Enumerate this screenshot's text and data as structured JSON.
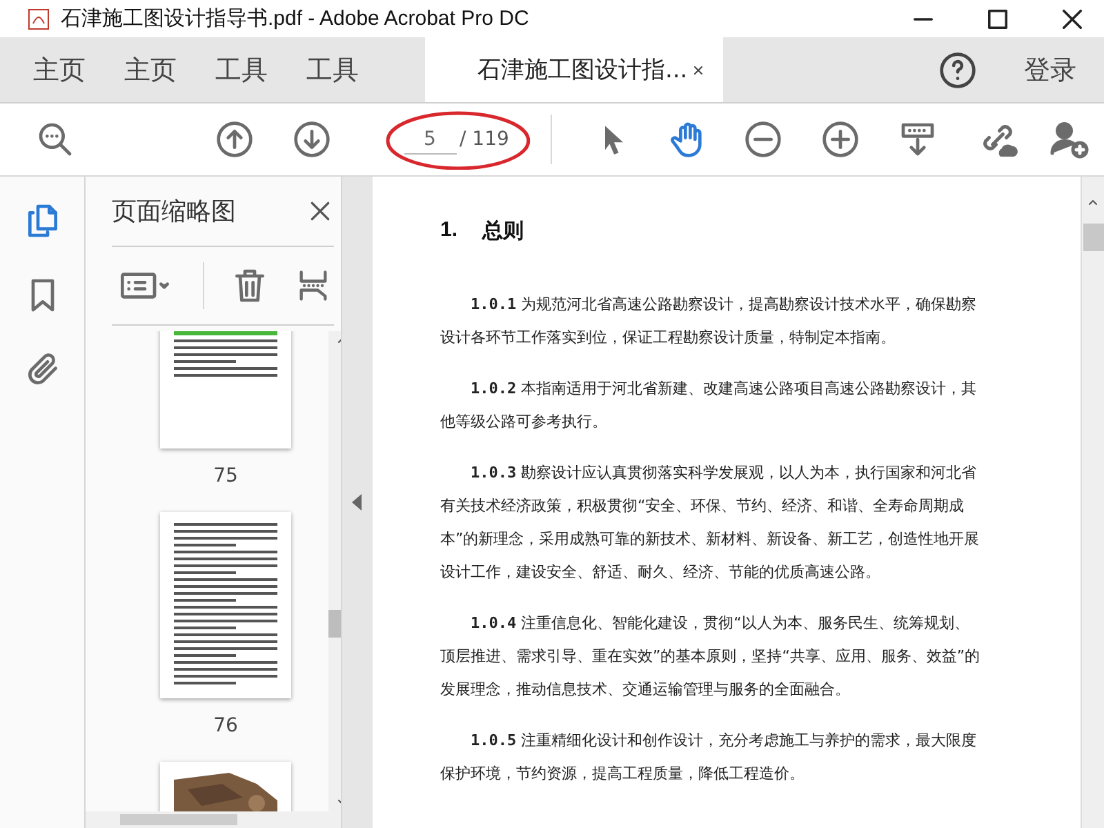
{
  "window": {
    "title": "石津施工图设计指导书.pdf - Adobe Acrobat Pro DC"
  },
  "tabs": [
    {
      "label": "主页",
      "kind": "nav",
      "selected": false
    },
    {
      "label": "主页",
      "kind": "nav",
      "selected": false
    },
    {
      "label": "工具",
      "kind": "nav",
      "selected": false
    },
    {
      "label": "工具",
      "kind": "nav",
      "selected": false
    },
    {
      "label": "石津施工图设计指...",
      "kind": "document",
      "selected": true
    }
  ],
  "signin": "登录",
  "toolbar": {
    "page_field": {
      "value": "5"
    },
    "page_total": "/ 119",
    "tools": [
      {
        "kind": "select",
        "selected": false
      },
      {
        "kind": "hand",
        "selected": true
      }
    ]
  },
  "side_rail": [
    {
      "kind": "thumbnails",
      "selected": true
    },
    {
      "kind": "bookmarks",
      "selected": false
    },
    {
      "kind": "attachments",
      "selected": false
    }
  ],
  "thumbnail_panel": {
    "title": "页面缩略图",
    "pages": [
      {
        "label": "75",
        "kind": "picture_page"
      },
      {
        "label": "76",
        "kind": "text_page"
      },
      {
        "kind": "photo_top_page"
      }
    ]
  },
  "document": {
    "heading_number": "1.",
    "heading": "总则",
    "paragraphs": [
      "**1.0.1** 为规范河北省高速公路勘察设计，提高勘察设计技术水平，确保勘察设计各环节工作落实到位，保证工程勘察设计质量，特制定本指南。",
      "**1.0.2** 本指南适用于河北省新建、改建高速公路项目高速公路勘察设计，其他等级公路可参考执行。",
      "**1.0.3** 勘察设计应认真贯彻落实科学发展观，以人为本，执行国家和河北省有关技术经济政策，积极贯彻“安全、环保、节约、经济、和谐、全寿命周期成本”的新理念，采用成熟可靠的新技术、新材料、新设备、新工艺，创造性地开展设计工作，建设安全、舒适、耐久、经济、节能的优质高速公路。",
      "**1.0.4** 注重信息化、智能化建设，贯彻“以人为本、服务民生、统筹规划、顶层推进、需求引导、重在实效”的基本原则，坚持“共享、应用、服务、效益”的发展理念，推动信息技术、交通运输管理与服务的全面融合。",
      "**1.0.5** 注重精细化设计和创作设计，充分考虑施工与养护的需求，最大限度保护环境，节约资源，提高工程质量，降低工程造价。"
    ]
  }
}
